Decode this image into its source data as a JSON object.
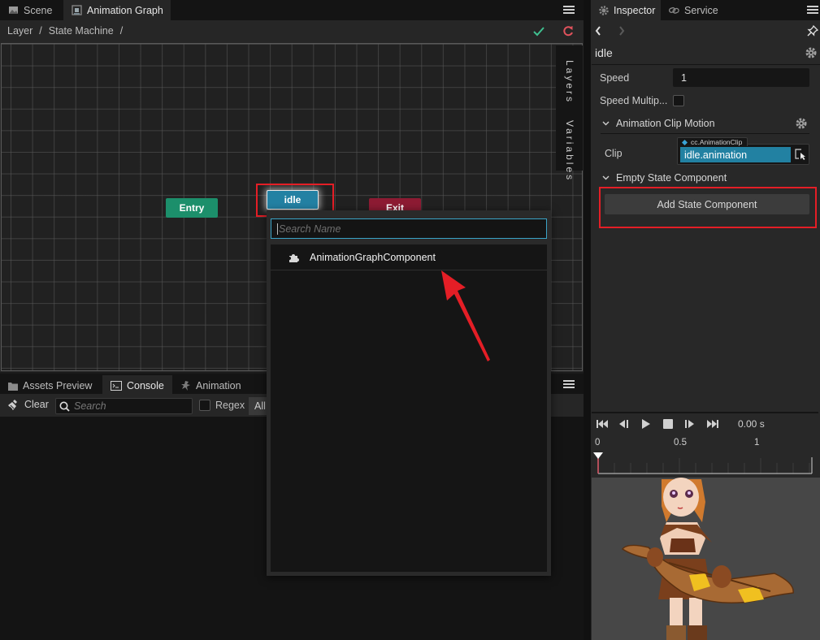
{
  "editor": {
    "tabs": [
      {
        "label": "Scene",
        "icon": "scene-icon",
        "active": false
      },
      {
        "label": "Animation Graph",
        "icon": "animation-graph-icon",
        "active": true
      }
    ],
    "breadcrumb": [
      "Layer",
      "/",
      "State Machine",
      "/"
    ],
    "actions": {
      "confirm_icon": "check-icon",
      "reset_icon": "reload-icon"
    },
    "side_tabs": [
      "Layers",
      "Variables"
    ],
    "nodes": [
      {
        "label": "Entry",
        "type": "entry",
        "color": "#1c8f6b"
      },
      {
        "label": "idle",
        "type": "state",
        "color": "#2381a3",
        "selected": true
      },
      {
        "label": "Exit",
        "type": "exit",
        "color": "#8d1b33"
      }
    ]
  },
  "popup": {
    "search_placeholder": "Search Name",
    "search_value": "",
    "items": [
      {
        "label": "AnimationGraphComponent",
        "icon": "puzzle-icon"
      }
    ]
  },
  "bottom": {
    "tabs": [
      {
        "label": "Assets Preview",
        "icon": "folder-icon",
        "active": false
      },
      {
        "label": "Console",
        "icon": "terminal-icon",
        "active": true
      },
      {
        "label": "Animation",
        "icon": "animation-icon",
        "active": false
      }
    ],
    "toolbar": {
      "clear_label": "Clear",
      "search_placeholder": "Search",
      "regex_label": "Regex",
      "regex_checked": false,
      "level_filter": "All"
    }
  },
  "inspector": {
    "tabs": [
      {
        "label": "Inspector",
        "icon": "gear-icon",
        "active": true
      },
      {
        "label": "Service",
        "icon": "link-icon",
        "active": false
      }
    ],
    "title": "idle",
    "properties": {
      "speed_label": "Speed",
      "speed_value": "1",
      "speed_multiplier_label": "Speed Multip...",
      "speed_multiplier_checked": false
    },
    "motion_section": {
      "title": "Animation Clip Motion",
      "clip_label": "Clip",
      "clip_type": "cc.AnimationClip",
      "clip_value": "idle.animation"
    },
    "component_section": {
      "title": "Empty State Component",
      "add_button": "Add State Component"
    },
    "player": {
      "time": "0.00 s",
      "ruler_labels": [
        "0",
        "0.5",
        "1"
      ],
      "controls": [
        "jump-to-start-icon",
        "prev-frame-icon",
        "play-icon",
        "stop-icon",
        "next-frame-icon",
        "jump-to-end-icon"
      ]
    },
    "preview_description": "3D character model holding a bow"
  },
  "colors": {
    "accent_blue": "#2381a3",
    "highlight_red": "#e41e26",
    "confirm_green": "#3fbf8f",
    "reset_red": "#e0525c"
  }
}
